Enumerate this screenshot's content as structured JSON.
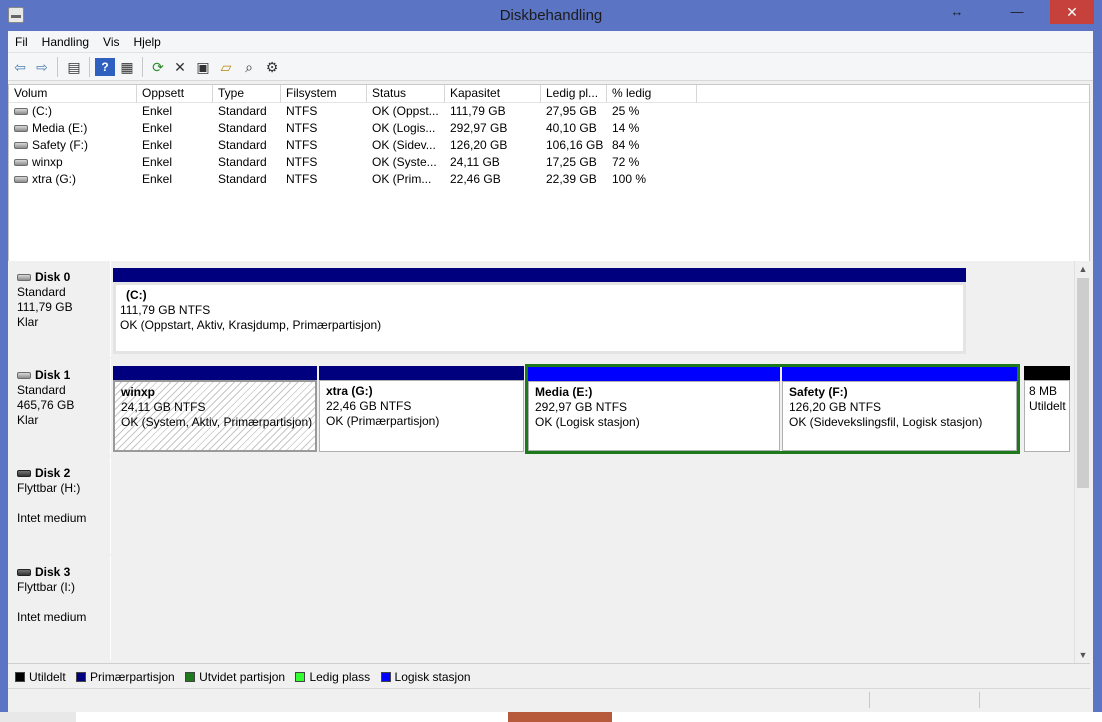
{
  "window": {
    "title": "Diskbehandling"
  },
  "titlebar_buttons": {
    "restore": "↔",
    "minimize": "—",
    "maximize": "□",
    "close": "✕"
  },
  "menu": [
    "Fil",
    "Handling",
    "Vis",
    "Hjelp"
  ],
  "toolbar": {
    "icons": [
      "back-arrow-icon",
      "forward-arrow-icon",
      "console-tree-icon",
      "help-icon",
      "properties-pane-icon",
      "refresh-icon",
      "delete-icon",
      "properties-icon",
      "open-folder-icon",
      "explore-icon",
      "settings-icon"
    ],
    "glyphs": {
      "back": "⇦",
      "forward": "⇨",
      "tree": "▤",
      "help": "?",
      "pane": "▦",
      "refresh": "⟳",
      "delete": "✕",
      "properties": "▣",
      "open": "▱",
      "explore": "⌕",
      "settings": "⚙"
    }
  },
  "volumes": {
    "columns": [
      "Volum",
      "Oppsett",
      "Type",
      "Filsystem",
      "Status",
      "Kapasitet",
      "Ledig pl...",
      "% ledig"
    ],
    "rows": [
      {
        "volum": "(C:)",
        "oppsett": "Enkel",
        "type": "Standard",
        "filsystem": "NTFS",
        "status": "OK (Oppst...",
        "kapasitet": "111,79 GB",
        "ledig": "27,95 GB",
        "prosent": "25 %"
      },
      {
        "volum": "Media (E:)",
        "oppsett": "Enkel",
        "type": "Standard",
        "filsystem": "NTFS",
        "status": "OK (Logis...",
        "kapasitet": "292,97 GB",
        "ledig": "40,10 GB",
        "prosent": "14 %"
      },
      {
        "volum": "Safety (F:)",
        "oppsett": "Enkel",
        "type": "Standard",
        "filsystem": "NTFS",
        "status": "OK (Sidev...",
        "kapasitet": "126,20 GB",
        "ledig": "106,16 GB",
        "prosent": "84 %"
      },
      {
        "volum": "winxp",
        "oppsett": "Enkel",
        "type": "Standard",
        "filsystem": "NTFS",
        "status": "OK (Syste...",
        "kapasitet": "24,11 GB",
        "ledig": "17,25 GB",
        "prosent": "72 %"
      },
      {
        "volum": "xtra (G:)",
        "oppsett": "Enkel",
        "type": "Standard",
        "filsystem": "NTFS",
        "status": "OK (Prim...",
        "kapasitet": "22,46 GB",
        "ledig": "22,39 GB",
        "prosent": "100 %"
      }
    ]
  },
  "disks": [
    {
      "name": "Disk 0",
      "type": "Standard",
      "size": "111,79 GB",
      "state": "Klar",
      "partitions": [
        {
          "name": "(C:)",
          "size": "111,79 GB NTFS",
          "status": "OK (Oppstart, Aktiv, Krasjdump, Primærpartisjon)"
        }
      ]
    },
    {
      "name": "Disk 1",
      "type": "Standard",
      "size": "465,76 GB",
      "state": "Klar",
      "partitions": [
        {
          "name": "winxp",
          "size": "24,11 GB NTFS",
          "status": "OK (System, Aktiv, Primærpartisjon)"
        },
        {
          "name": "xtra  (G:)",
          "size": "22,46 GB NTFS",
          "status": "OK (Primærpartisjon)"
        },
        {
          "name": "Media  (E:)",
          "size": "292,97 GB NTFS",
          "status": "OK (Logisk stasjon)"
        },
        {
          "name": "Safety  (F:)",
          "size": "126,20 GB NTFS",
          "status": "OK (Sidevekslingsfil, Logisk stasjon)"
        },
        {
          "name": "",
          "size": "8 MB",
          "status": "Utildelt"
        }
      ]
    },
    {
      "name": "Disk 2",
      "type": "Flyttbar (H:)",
      "size": "",
      "state": "Intet medium"
    },
    {
      "name": "Disk 3",
      "type": "Flyttbar (I:)",
      "size": "",
      "state": "Intet medium"
    }
  ],
  "legend": [
    {
      "label": "Utildelt",
      "color": "#000000"
    },
    {
      "label": "Primærpartisjon",
      "color": "#00007f"
    },
    {
      "label": "Utvidet partisjon",
      "color": "#1c7a1c"
    },
    {
      "label": "Ledig plass",
      "color": "#33ff33"
    },
    {
      "label": "Logisk stasjon",
      "color": "#0000ff"
    }
  ],
  "colors": {
    "primary_bar": "#00007f",
    "logical_bar": "#0000ff",
    "unallocated_bar": "#000000",
    "extended_frame": "#1c7a1c",
    "title_bar": "#5b74c4"
  }
}
